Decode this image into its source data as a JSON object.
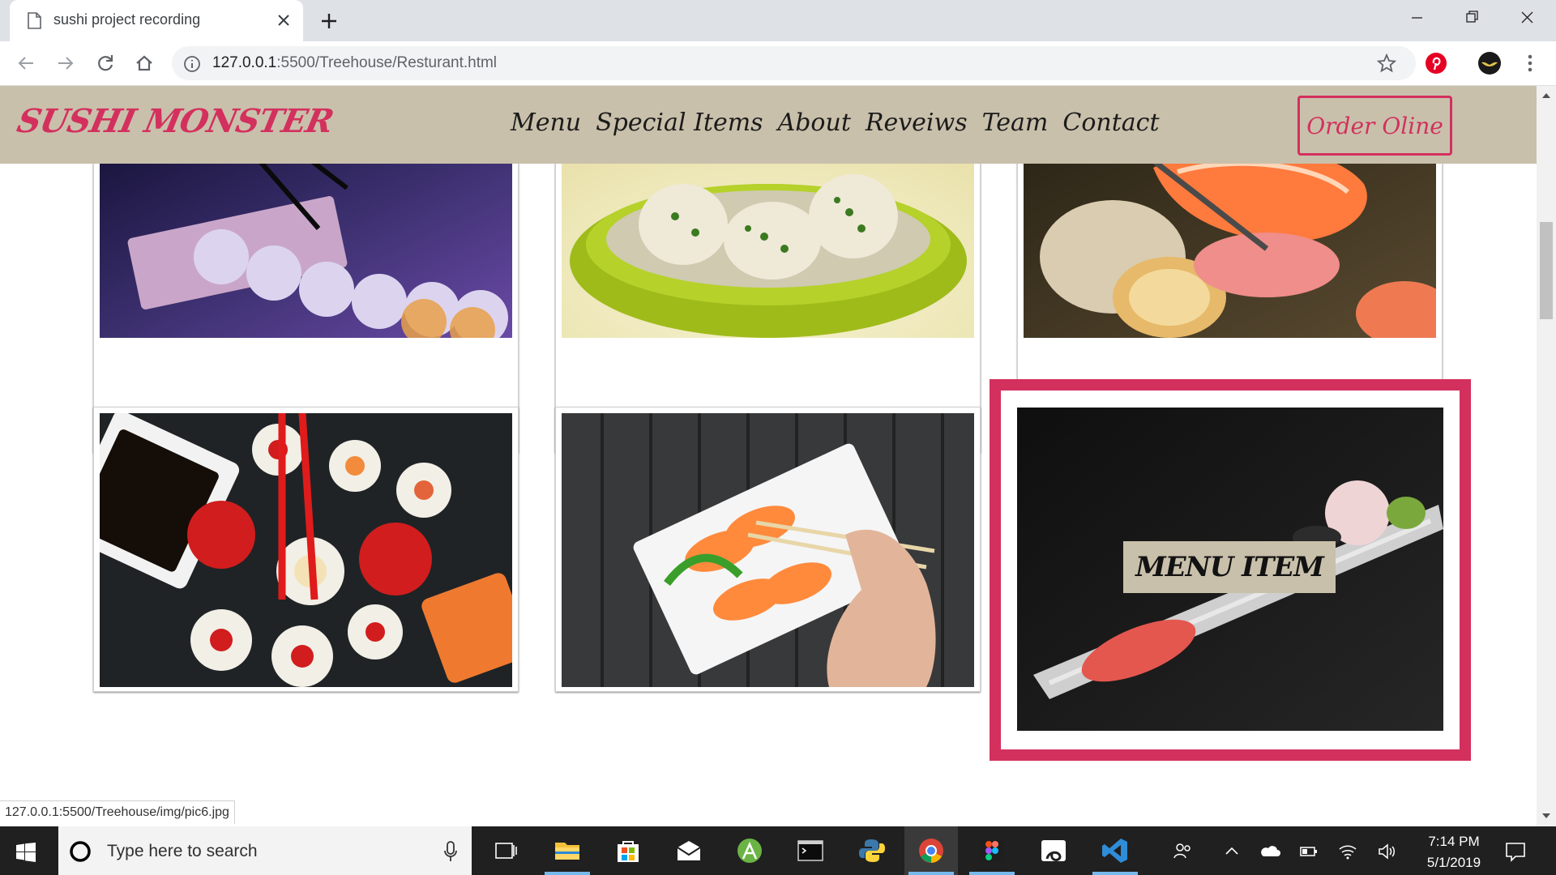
{
  "browser": {
    "tab_title": "sushi project recording",
    "url_host": "127.0.0.1",
    "url_rest": ":5500/Treehouse/Resturant.html",
    "status_url": "127.0.0.1:5500/Treehouse/img/pic6.jpg"
  },
  "site": {
    "logo": "SUSHI MONSTER",
    "nav": [
      "Menu",
      "Special Items",
      "About",
      "Reveiws",
      "Team",
      "Contact"
    ],
    "order_button": "Order Oline",
    "menu_item_label": "MENU ITEM",
    "accent_color": "#d3305e",
    "header_color": "#c9c0ab"
  },
  "taskbar": {
    "search_placeholder": "Type here to search",
    "time": "7:14 PM",
    "date": "5/1/2019"
  },
  "icons": [
    "document-icon",
    "close-icon",
    "plus-icon",
    "back-icon",
    "forward-icon",
    "reload-icon",
    "home-icon",
    "info-icon",
    "star-icon",
    "pinterest-icon",
    "extension-icon",
    "menu-kebab-icon",
    "windows-start-icon",
    "cortana-icon",
    "microphone-icon",
    "task-view-icon",
    "file-explorer-icon",
    "store-icon",
    "mail-icon",
    "android-studio-icon",
    "terminal-icon",
    "python-icon",
    "chrome-icon",
    "figma-icon",
    "app-icon",
    "vscode-icon",
    "people-icon",
    "chevron-up-icon",
    "onedrive-icon",
    "network-icon",
    "battery-icon",
    "wifi-icon",
    "volume-icon",
    "notification-icon"
  ]
}
